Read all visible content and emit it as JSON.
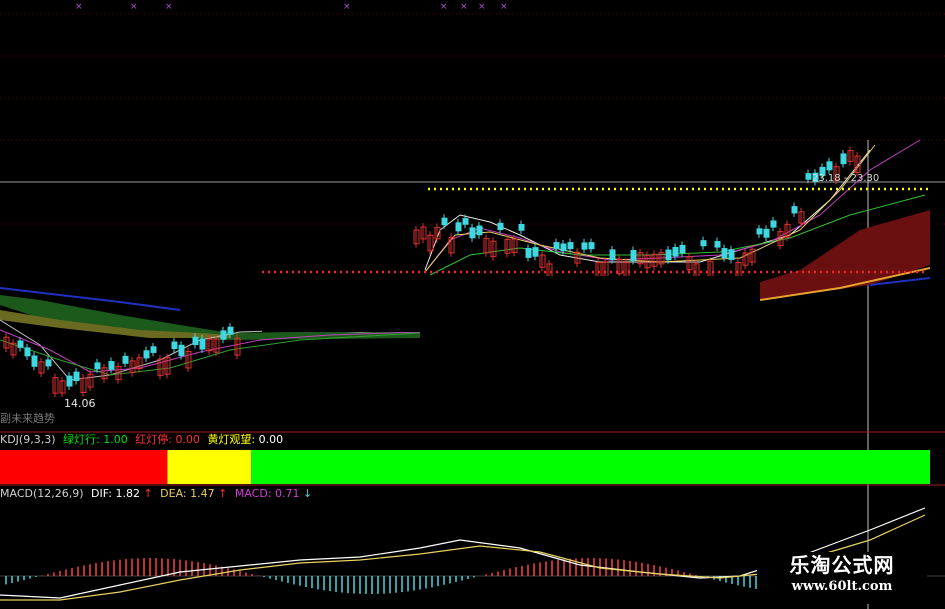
{
  "colors": {
    "background": "#000000",
    "grid": "#5a0000",
    "candle_up": "#e03030",
    "candle_down": "#40d8e0",
    "signal_red": "#ff0000",
    "signal_yellow": "#ffff00",
    "signal_green": "#00ff00",
    "dif_line": "#ffffff",
    "dea_line": "#e8d060",
    "macd_up_bar": "#ff4040",
    "macd_down_bar": "#40d8e0",
    "support_line": "#ff2020",
    "resistance_line": "#ffff00"
  },
  "main_panel": {
    "low_label": "14.06",
    "range_label": "23.18 - 23.30",
    "caption": "副未来趋势"
  },
  "kdj_panel": {
    "indicator": "KDJ(9,3,3)",
    "green_label": "绿灯行:",
    "green_value": "1.00",
    "red_label": "红灯停:",
    "red_value": "0.00",
    "yellow_label": "黄灯观望:",
    "yellow_value": "0.00"
  },
  "macd_panel": {
    "indicator": "MACD(12,26,9)",
    "dif_label": "DIF:",
    "dif_value": "1.82",
    "dif_arrow": "↑",
    "dea_label": "DEA:",
    "dea_value": "1.47",
    "dea_arrow": "↑",
    "macd_label": "MACD:",
    "macd_value": "0.71",
    "macd_arrow": "↓"
  },
  "watermark": {
    "title": "乐淘公式网",
    "url": "www.60lt.com"
  },
  "chart_data": {
    "type": "line",
    "title": "",
    "xlabel": "",
    "ylabel": "",
    "grid": true,
    "price_range": [
      13.5,
      25.5
    ],
    "annotations": {
      "low_price": 14.06,
      "resistance_range": [
        23.18,
        23.3
      ]
    },
    "signal_bar": {
      "segments": [
        {
          "state": "red",
          "fraction": 0.18
        },
        {
          "state": "yellow",
          "fraction": 0.09
        },
        {
          "state": "green",
          "fraction": 0.73
        }
      ]
    },
    "macd": {
      "dif": 1.82,
      "dea": 1.47,
      "macd": 0.71
    }
  }
}
